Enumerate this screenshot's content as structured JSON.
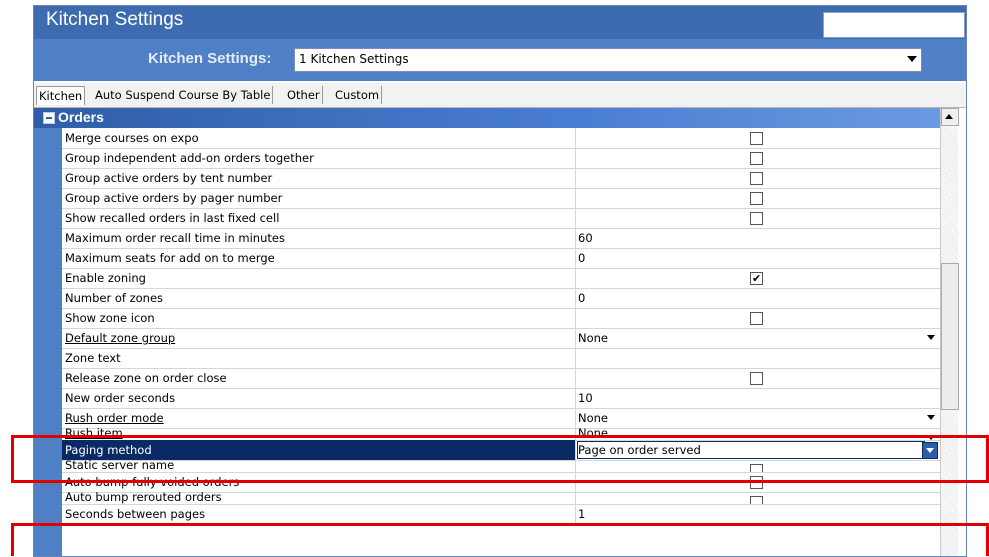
{
  "window": {
    "title": "Kitchen Settings"
  },
  "selector": {
    "label": "Kitchen Settings:",
    "value": "1 Kitchen Settings"
  },
  "tabs": [
    "Kitchen",
    "Auto Suspend Course By Table",
    "Other",
    "Custom"
  ],
  "section": {
    "title": "Orders"
  },
  "rows": [
    {
      "name": "Merge courses on expo",
      "type": "checkbox",
      "checked": false
    },
    {
      "name": "Group independent add-on orders together",
      "type": "checkbox",
      "checked": false
    },
    {
      "name": "Group active orders by tent number",
      "type": "checkbox",
      "checked": false
    },
    {
      "name": "Group active orders by pager number",
      "type": "checkbox",
      "checked": false
    },
    {
      "name": "Show recalled orders in last fixed cell",
      "type": "checkbox",
      "checked": false
    },
    {
      "name": "Maximum order recall time in minutes",
      "type": "text",
      "value": "60"
    },
    {
      "name": "Maximum seats for add on to merge",
      "type": "text",
      "value": "0"
    },
    {
      "name": "Enable zoning",
      "type": "checkbox",
      "checked": true
    },
    {
      "name": "Number of zones",
      "type": "text",
      "value": "0"
    },
    {
      "name": "Show zone icon",
      "type": "checkbox",
      "checked": false
    },
    {
      "name": "Default zone group",
      "type": "dropdown",
      "value": "None"
    },
    {
      "name": "Zone text",
      "type": "text",
      "value": ""
    },
    {
      "name": "Release zone on order close",
      "type": "checkbox",
      "checked": false
    },
    {
      "name": "New order seconds",
      "type": "text",
      "value": "10"
    },
    {
      "name": "Rush order mode",
      "type": "dropdown",
      "value": "None"
    },
    {
      "name": "Rush item",
      "type": "dropdown",
      "value": "None"
    },
    {
      "name": "Paging method",
      "type": "dropdown",
      "value": "Page on order served",
      "selected": true
    },
    {
      "name": "Static server name",
      "type": "checkbox",
      "checked": false
    },
    {
      "name": "Auto bump fully voided orders",
      "type": "checkbox",
      "checked": false
    },
    {
      "name": "Auto bump rerouted orders",
      "type": "checkbox",
      "checked": false
    },
    {
      "name": "Seconds between pages",
      "type": "text",
      "value": "1"
    }
  ],
  "colors": {
    "titlebar": "#3d6bb0",
    "selection": "#0a2a66",
    "highlight": "#e10000"
  }
}
